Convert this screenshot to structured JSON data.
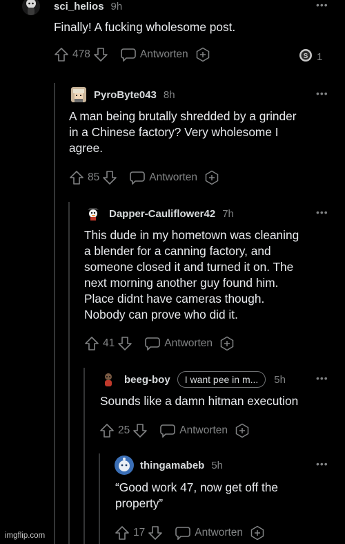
{
  "reply_label": "Antworten",
  "comments": [
    {
      "author": "sci_helios",
      "time": "9h",
      "body": "Finally! A fucking wholesome post.",
      "upvotes": "478",
      "award_count": "1",
      "avatar_icon": "snoo-avatar-icon"
    },
    {
      "author": "PyroByte043",
      "time": "8h",
      "body": "A man being brutally shredded by a grinder\nin a Chinese factory? Very wholesome I\nagree.",
      "upvotes": "85",
      "avatar_icon": "pixel-avatar-icon"
    },
    {
      "author": "Dapper-Cauliflower42",
      "time": "7h",
      "body": "This dude in my hometown was cleaning\na blender for a canning factory, and\nsomeone closed it and turned it on. The\nnext morning another guy found him.\nPlace didnt have cameras though.\nNobody can prove who did it.",
      "upvotes": "41",
      "avatar_icon": "duck-avatar-icon"
    },
    {
      "author": "beeg-boy",
      "time": "5h",
      "flair": "I want pee in m...",
      "body": "Sounds like a damn hitman execution",
      "upvotes": "25",
      "avatar_icon": "snoo-avatar-icon"
    },
    {
      "author": "thingamabeb",
      "time": "5h",
      "body": "“Good work 47, now get off the\nproperty”",
      "upvotes": "17",
      "avatar_icon": "blue-snoo-avatar-icon"
    }
  ],
  "watermark": "imgflip.com",
  "colors": {
    "background": "#000000",
    "text": "#e8eaed",
    "muted": "#818384",
    "thread_line": "#343536"
  }
}
